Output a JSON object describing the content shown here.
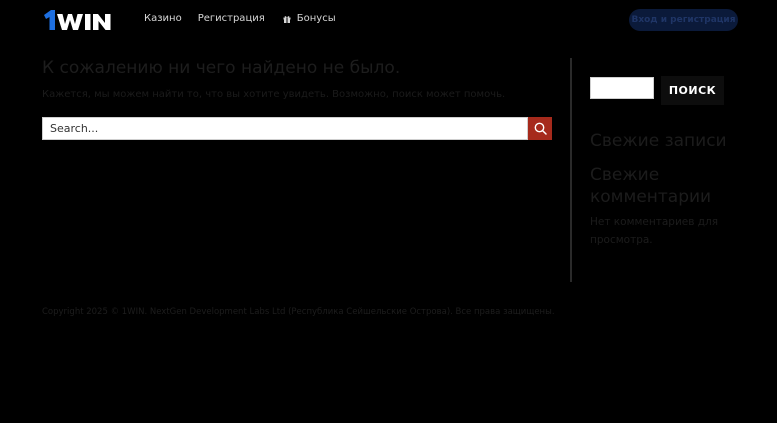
{
  "header": {
    "logo_text": "1WIN",
    "nav": [
      {
        "label": "Казино"
      },
      {
        "label": "Регистрация"
      },
      {
        "label": "Бонусы"
      }
    ],
    "login_label": "Вход и регистрация"
  },
  "main": {
    "title": "К сожалению ни чего найдено не было.",
    "subtitle": "Кажется, мы можем найти то, что вы хотите увидеть. Возможно, поиск может помочь.",
    "search_placeholder": "Search..."
  },
  "sidebar": {
    "search_button": "ПОИСК",
    "recent_posts_title": "Свежие записи",
    "recent_comments_title": "Свежие комментарии",
    "no_comments_text": "Нет комментариев для просмотра."
  },
  "footer": {
    "copyright": "Copyright 2025 © 1WIN. NextGen Development Labs Ltd (Республика Сейшельские Острова). Все права защищены."
  },
  "colors": {
    "background": "#000000",
    "search_button": "#a62a1c",
    "login_button": "#0b1a3a"
  }
}
